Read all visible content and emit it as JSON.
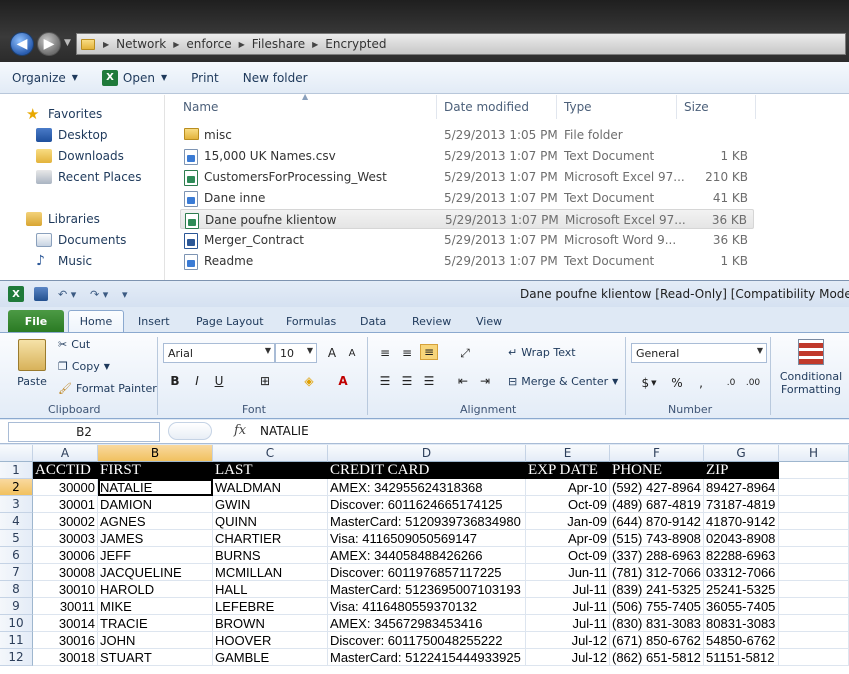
{
  "explorer": {
    "breadcrumb": [
      "Network",
      "enforce",
      "Fileshare",
      "Encrypted"
    ],
    "toolbar": {
      "organize": "Organize",
      "open": "Open",
      "print": "Print",
      "new_folder": "New folder"
    },
    "nav": {
      "favorites": "Favorites",
      "desktop": "Desktop",
      "downloads": "Downloads",
      "recent": "Recent Places",
      "libraries": "Libraries",
      "documents": "Documents",
      "music": "Music"
    },
    "columns": {
      "name": "Name",
      "date": "Date modified",
      "type": "Type",
      "size": "Size"
    },
    "files": [
      {
        "name": "misc",
        "date": "5/29/2013 1:05 PM",
        "type": "File folder",
        "size": "",
        "icon": "folder-icon"
      },
      {
        "name": "15,000 UK Names.csv",
        "date": "5/29/2013 1:07 PM",
        "type": "Text Document",
        "size": "1 KB",
        "icon": "text-file-icon"
      },
      {
        "name": "CustomersForProcessing_West",
        "date": "5/29/2013 1:07 PM",
        "type": "Microsoft Excel 97...",
        "size": "210 KB",
        "icon": "excel-file-icon"
      },
      {
        "name": "Dane inne",
        "date": "5/29/2013 1:07 PM",
        "type": "Text Document",
        "size": "41 KB",
        "icon": "text-file-icon"
      },
      {
        "name": "Dane poufne klientow",
        "date": "5/29/2013 1:07 PM",
        "type": "Microsoft Excel 97...",
        "size": "36 KB",
        "icon": "excel-file-icon"
      },
      {
        "name": "Merger_Contract",
        "date": "5/29/2013 1:07 PM",
        "type": "Microsoft Word 9...",
        "size": "36 KB",
        "icon": "word-file-icon"
      },
      {
        "name": "Readme",
        "date": "5/29/2013 1:07 PM",
        "type": "Text Document",
        "size": "1 KB",
        "icon": "text-file-icon"
      }
    ]
  },
  "excel": {
    "title": "Dane poufne klientow  [Read-Only]  [Compatibility Mode]  -  M",
    "tabs": [
      "File",
      "Home",
      "Insert",
      "Page Layout",
      "Formulas",
      "Data",
      "Review",
      "View"
    ],
    "ribbon": {
      "paste": "Paste",
      "cut": "Cut",
      "copy": "Copy",
      "format_painter": "Format Painter",
      "clipboard": "Clipboard",
      "font_name": "Arial",
      "font_size": "10",
      "font": "Font",
      "wrap_text": "Wrap Text",
      "merge_center": "Merge & Center",
      "alignment": "Alignment",
      "number_format": "General",
      "number": "Number",
      "conditional": "Conditional",
      "formatting": "Formatting",
      "currency": "$",
      "percent": "%",
      "comma": ","
    },
    "namebox": "B2",
    "fx": "fx",
    "formula_value": "NATALIE",
    "columns": [
      "A",
      "B",
      "C",
      "D",
      "E",
      "F",
      "G",
      "H"
    ],
    "rows": [
      "1",
      "2",
      "3",
      "4",
      "5",
      "6",
      "7",
      "8",
      "9",
      "10",
      "11",
      "12"
    ],
    "headers": [
      "ACCTID",
      "FIRST",
      "LAST",
      "CREDIT CARD",
      "EXP DATE",
      "PHONE",
      "ZIP"
    ],
    "data": [
      [
        "30000",
        "NATALIE",
        "WALDMAN",
        "AMEX: 342955624318368",
        "Apr-10",
        "(592) 427-8964",
        "89427-8964"
      ],
      [
        "30001",
        "DAMION",
        "GWIN",
        "Discover: 6011624665174125",
        "Oct-09",
        "(489) 687-4819",
        "73187-4819"
      ],
      [
        "30002",
        "AGNES",
        "QUINN",
        "MasterCard: 5120939736834980",
        "Jan-09",
        "(644) 870-9142",
        "41870-9142"
      ],
      [
        "30003",
        "JAMES",
        "CHARTIER",
        "Visa: 4116509050569147",
        "Apr-09",
        "(515) 743-8908",
        "02043-8908"
      ],
      [
        "30006",
        "JEFF",
        "BURNS",
        "AMEX: 344058488426266",
        "Oct-09",
        "(337) 288-6963",
        "82288-6963"
      ],
      [
        "30008",
        "JACQUELINE",
        "MCMILLAN",
        "Discover: 6011976857117225",
        "Jun-11",
        "(781) 312-7066",
        "03312-7066"
      ],
      [
        "30010",
        "HAROLD",
        "HALL",
        "MasterCard: 5123695007103193",
        "Jul-11",
        "(839) 241-5325",
        "25241-5325"
      ],
      [
        "30011",
        "MIKE",
        "LEFEBRE",
        "Visa: 4116480559370132",
        "Jul-11",
        "(506) 755-7405",
        "36055-7405"
      ],
      [
        "30014",
        "TRACIE",
        "BROWN",
        "AMEX: 345672983453416",
        "Jul-11",
        "(830) 831-3083",
        "80831-3083"
      ],
      [
        "30016",
        "JOHN",
        "HOOVER",
        "Discover: 6011750048255222",
        "Jul-12",
        "(671) 850-6762",
        "54850-6762"
      ],
      [
        "30018",
        "STUART",
        "GAMBLE",
        "MasterCard: 5122415444933925",
        "Jul-12",
        "(862) 651-5812",
        "51151-5812"
      ]
    ]
  }
}
